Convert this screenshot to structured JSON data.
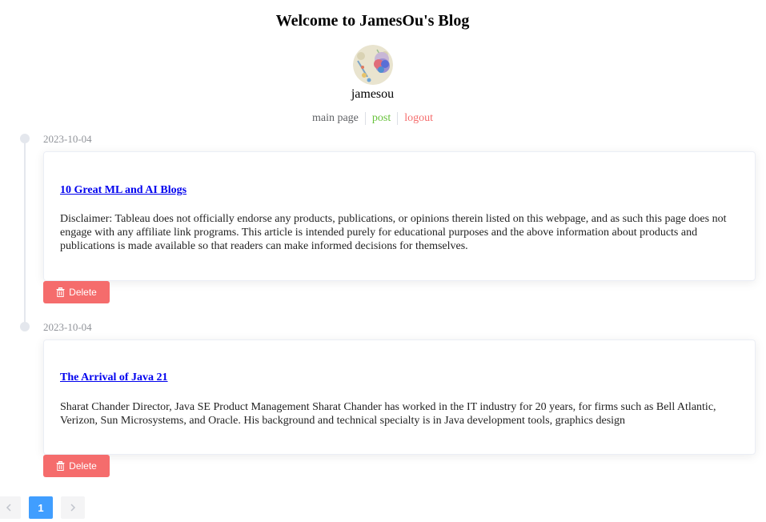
{
  "header": {
    "title": "Welcome to JamesOu's Blog",
    "username": "jamesou"
  },
  "nav": {
    "main_page": "main page",
    "post": "post",
    "logout": "logout"
  },
  "posts": [
    {
      "date": "2023-10-04",
      "title": "10 Great ML and AI Blogs",
      "excerpt": "Disclaimer: Tableau does not officially endorse any products, publications, or opinions therein listed on this webpage, and as such this page does not engage with any affiliate link programs. This article is intended purely for educational purposes and the above information about products and publications is made available so that readers can make informed decisions for themselves.",
      "delete_label": "Delete"
    },
    {
      "date": "2023-10-04",
      "title": "The Arrival of Java 21",
      "excerpt": "Sharat Chander Director, Java SE Product Management Sharat Chander has worked in the IT industry for 20 years, for firms such as Bell Atlantic, Verizon, Sun Microsystems, and Oracle. His background and technical specialty is in Java development tools, graphics design",
      "delete_label": "Delete"
    }
  ],
  "pagination": {
    "current_page": "1",
    "prev_icon": "chevron-left-icon",
    "next_icon": "chevron-right-icon"
  },
  "colors": {
    "post_link": "#67c23a",
    "logout_link": "#f56c6c",
    "delete_button": "#f56c6c",
    "active_page": "#409eff"
  }
}
